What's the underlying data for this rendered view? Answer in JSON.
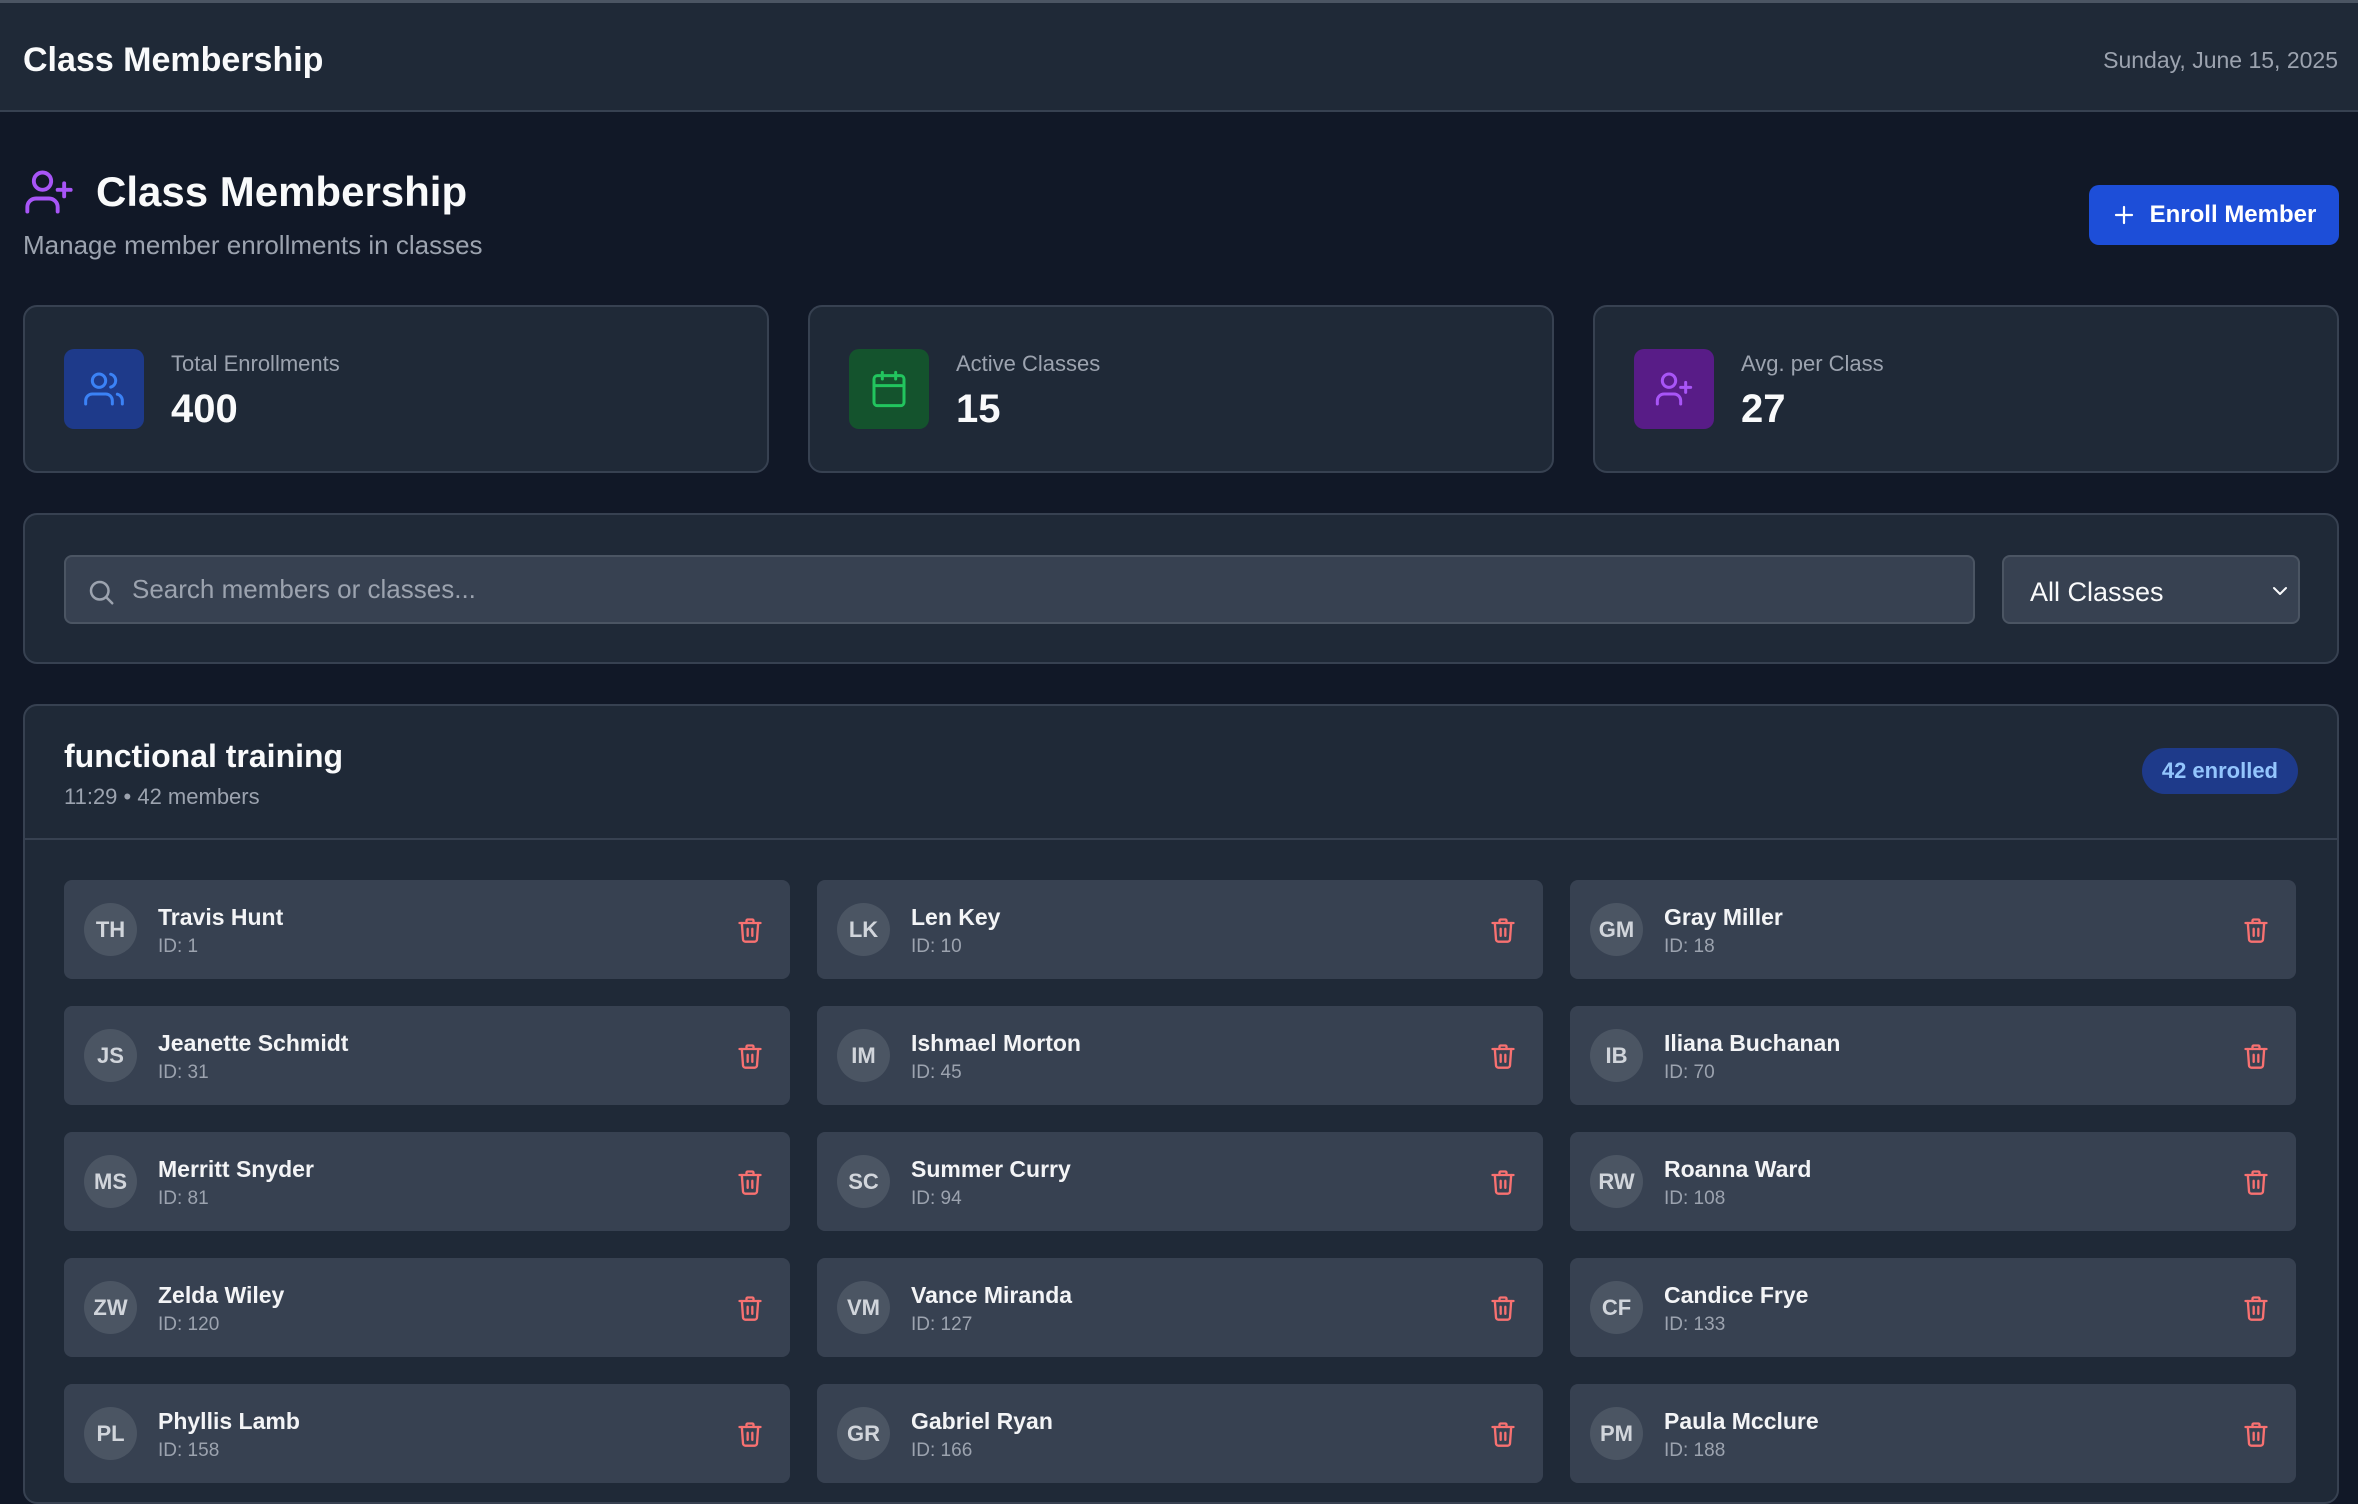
{
  "topbar": {
    "title": "Class Membership",
    "date": "Sunday, June 15, 2025"
  },
  "header": {
    "title": "Class Membership",
    "subtitle": "Manage member enrollments in classes",
    "enroll_label": "Enroll Member",
    "title_icon": "user-plus-icon"
  },
  "stats": [
    {
      "label": "Total Enrollments",
      "value": "400",
      "icon": "users-icon",
      "color": "#2563eb"
    },
    {
      "label": "Active Classes",
      "value": "15",
      "icon": "calendar-icon",
      "color": "#16a34a"
    },
    {
      "label": "Avg. per Class",
      "value": "27",
      "icon": "user-plus-icon",
      "color": "#9333ea"
    }
  ],
  "filters": {
    "search_placeholder": "Search members or classes...",
    "search_value": "",
    "class_select": "All Classes"
  },
  "class_group": {
    "name": "functional training",
    "meta": "11:29 • 42 members",
    "badge": "42 enrolled",
    "members": [
      {
        "initials": "TH",
        "name": "Travis Hunt",
        "id": "ID: 1"
      },
      {
        "initials": "LK",
        "name": "Len Key",
        "id": "ID: 10"
      },
      {
        "initials": "GM",
        "name": "Gray Miller",
        "id": "ID: 18"
      },
      {
        "initials": "JS",
        "name": "Jeanette Schmidt",
        "id": "ID: 31"
      },
      {
        "initials": "IM",
        "name": "Ishmael Morton",
        "id": "ID: 45"
      },
      {
        "initials": "IB",
        "name": "Iliana Buchanan",
        "id": "ID: 70"
      },
      {
        "initials": "MS",
        "name": "Merritt Snyder",
        "id": "ID: 81"
      },
      {
        "initials": "SC",
        "name": "Summer Curry",
        "id": "ID: 94"
      },
      {
        "initials": "RW",
        "name": "Roanna Ward",
        "id": "ID: 108"
      },
      {
        "initials": "ZW",
        "name": "Zelda Wiley",
        "id": "ID: 120"
      },
      {
        "initials": "VM",
        "name": "Vance Miranda",
        "id": "ID: 127"
      },
      {
        "initials": "CF",
        "name": "Candice Frye",
        "id": "ID: 133"
      },
      {
        "initials": "PL",
        "name": "Phyllis Lamb",
        "id": "ID: 158"
      },
      {
        "initials": "GR",
        "name": "Gabriel Ryan",
        "id": "ID: 166"
      },
      {
        "initials": "PM",
        "name": "Paula Mcclure",
        "id": "ID: 188"
      }
    ]
  },
  "colors": {
    "accent": "#1d4ed8",
    "danger": "#f87171",
    "panel": "#1f2937",
    "background": "#111827"
  }
}
